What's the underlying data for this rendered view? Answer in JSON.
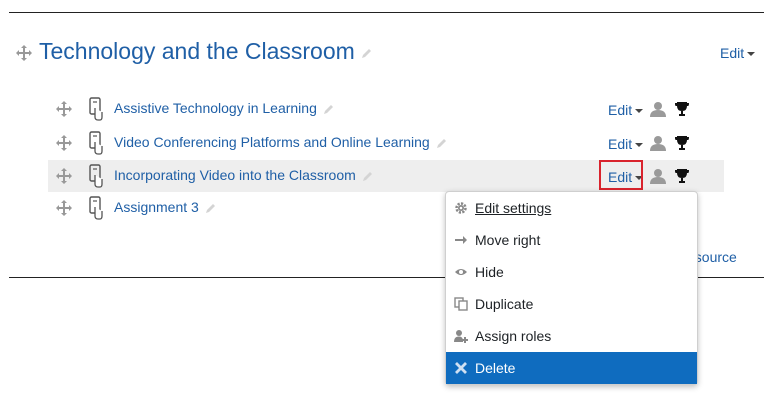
{
  "section": {
    "title": "Technology and the Classroom",
    "edit_label": "Edit"
  },
  "activities": [
    {
      "name": "Assistive Technology in Learning",
      "edit_label": "Edit"
    },
    {
      "name": "Video Conferencing Platforms and Online Learning",
      "edit_label": "Edit"
    },
    {
      "name": "Incorporating Video into the Classroom",
      "edit_label": "Edit"
    },
    {
      "name": "Assignment 3"
    }
  ],
  "add_link_partial": "esource",
  "dropdown": {
    "items": [
      {
        "label": "Edit settings",
        "icon": "gear-icon"
      },
      {
        "label": "Move right",
        "icon": "arrow-right-icon"
      },
      {
        "label": "Hide",
        "icon": "eye-icon"
      },
      {
        "label": "Duplicate",
        "icon": "duplicate-icon"
      },
      {
        "label": "Assign roles",
        "icon": "assign-roles-icon"
      },
      {
        "label": "Delete",
        "icon": "delete-icon"
      }
    ],
    "active_color": "#0f6cbf"
  },
  "colors": {
    "link": "#1f5fa6",
    "highlight_border": "#d9232d",
    "row_highlight": "#eeeeee"
  }
}
